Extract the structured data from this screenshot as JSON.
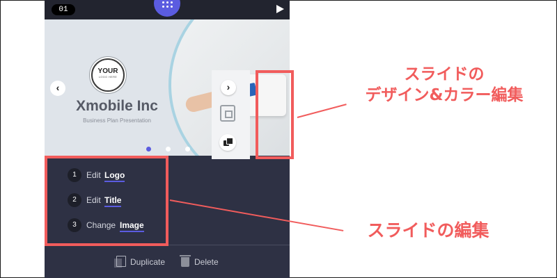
{
  "topbar": {
    "slide_number": "01",
    "menu_icon": "grid-dots-icon",
    "play_icon": "play-icon"
  },
  "slide": {
    "logo_line1": "YOUR",
    "logo_line2": "LOGO HERE",
    "company_name": "Xmobile Inc",
    "tagline": "Business Plan Presentation",
    "prev_glyph": "‹",
    "next_glyph": "›",
    "pager": {
      "count": 3,
      "active_index": 0,
      "active_color": "#5b5ce0",
      "inactive_color": "#ffffff"
    }
  },
  "side_tools": {
    "design_icon": "square-design-icon",
    "color_icon": "color-swatch-icon"
  },
  "edit_items": [
    {
      "num": "1",
      "verb": "Edit",
      "target": "Logo"
    },
    {
      "num": "2",
      "verb": "Edit",
      "target": "Title"
    },
    {
      "num": "3",
      "verb": "Change",
      "target": "Image"
    }
  ],
  "bottom_bar": {
    "duplicate_label": "Duplicate",
    "delete_label": "Delete"
  },
  "annotations": {
    "design_color_line1": "スライドの",
    "design_color_line2": "デザイン&カラー編集",
    "edit_slide": "スライドの編集"
  },
  "colors": {
    "accent": "#5b5ce0",
    "highlight": "#f15c5c",
    "panel": "#2e3144"
  }
}
